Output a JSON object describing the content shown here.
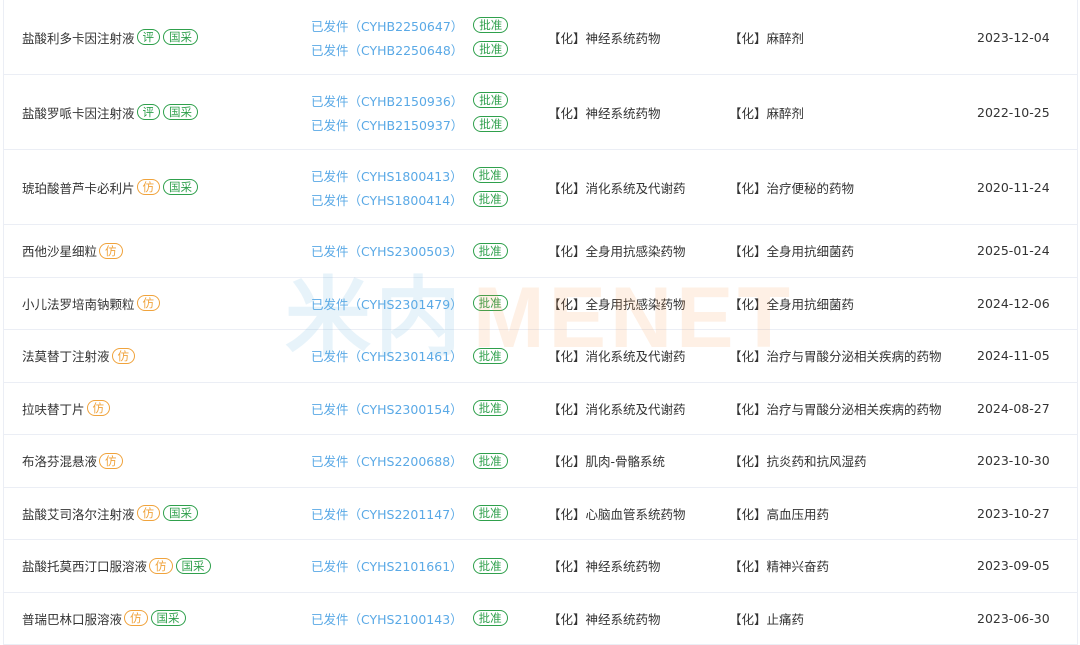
{
  "labels": {
    "approved": "批准",
    "eval": "评",
    "generic": "仿",
    "guocai": "国采"
  },
  "watermark": {
    "cn": "米内",
    "en": "MENET"
  },
  "colors": {
    "link_blue": "#5aa9e6",
    "badge_green": "#2fa04c",
    "badge_orange": "#f0a33c",
    "row_border": "#ebeef5"
  },
  "rows": [
    {
      "name": "盐酸利多卡因注射液",
      "regs": [
        "已发件（CYHB2250647）",
        "已发件（CYHB2250648）"
      ],
      "cat1": "【化】神经系统药物",
      "cat2": "【化】麻醉剂",
      "date": "2023-12-04"
    },
    {
      "name": "盐酸罗哌卡因注射液",
      "regs": [
        "已发件（CYHB2150936）",
        "已发件（CYHB2150937）"
      ],
      "cat1": "【化】神经系统药物",
      "cat2": "【化】麻醉剂",
      "date": "2022-10-25"
    },
    {
      "name": "琥珀酸普芦卡必利片",
      "regs": [
        "已发件（CYHS1800413）",
        "已发件（CYHS1800414）"
      ],
      "cat1": "【化】消化系统及代谢药",
      "cat2": "【化】治疗便秘的药物",
      "date": "2020-11-24"
    },
    {
      "name": "西他沙星细粒",
      "regs": [
        "已发件（CYHS2300503）"
      ],
      "cat1": "【化】全身用抗感染药物",
      "cat2": "【化】全身用抗细菌药",
      "date": "2025-01-24"
    },
    {
      "name": "小儿法罗培南钠颗粒",
      "regs": [
        "已发件（CYHS2301479）"
      ],
      "cat1": "【化】全身用抗感染药物",
      "cat2": "【化】全身用抗细菌药",
      "date": "2024-12-06"
    },
    {
      "name": "法莫替丁注射液",
      "regs": [
        "已发件（CYHS2301461）"
      ],
      "cat1": "【化】消化系统及代谢药",
      "cat2": "【化】治疗与胃酸分泌相关疾病的药物",
      "date": "2024-11-05"
    },
    {
      "name": "拉呋替丁片",
      "regs": [
        "已发件（CYHS2300154）"
      ],
      "cat1": "【化】消化系统及代谢药",
      "cat2": "【化】治疗与胃酸分泌相关疾病的药物",
      "date": "2024-08-27"
    },
    {
      "name": "布洛芬混悬液",
      "regs": [
        "已发件（CYHS2200688）"
      ],
      "cat1": "【化】肌肉-骨骼系统",
      "cat2": "【化】抗炎药和抗风湿药",
      "date": "2023-10-30"
    },
    {
      "name": "盐酸艾司洛尔注射液",
      "regs": [
        "已发件（CYHS2201147）"
      ],
      "cat1": "【化】心脑血管系统药物",
      "cat2": "【化】高血压用药",
      "date": "2023-10-27"
    },
    {
      "name": "盐酸托莫西汀口服溶液",
      "regs": [
        "已发件（CYHS2101661）"
      ],
      "cat1": "【化】神经系统药物",
      "cat2": "【化】精神兴奋药",
      "date": "2023-09-05"
    },
    {
      "name": "普瑞巴林口服溶液",
      "regs": [
        "已发件（CYHS2100143）"
      ],
      "cat1": "【化】神经系统药物",
      "cat2": "【化】止痛药",
      "date": "2023-06-30"
    }
  ]
}
